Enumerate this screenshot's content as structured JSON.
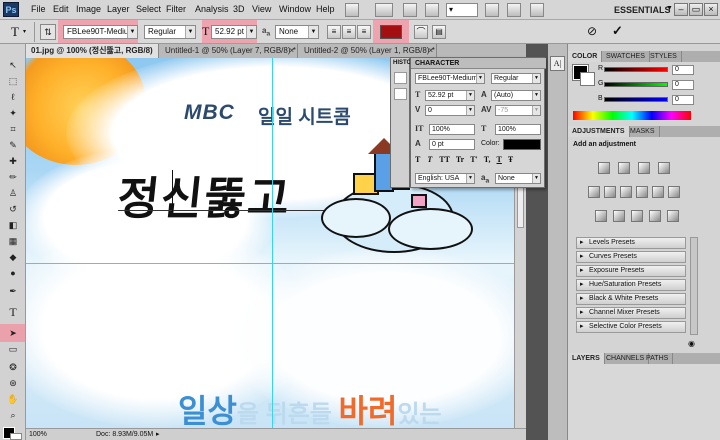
{
  "app": {
    "logo": "Ps",
    "workspace": "ESSENTIALS",
    "workspace_arrow": "▼"
  },
  "menu": [
    "File",
    "Edit",
    "Image",
    "Layer",
    "Select",
    "Filter",
    "Analysis",
    "3D",
    "View",
    "Window",
    "Help"
  ],
  "window_controls": {
    "minimize": "–",
    "restore": "▭",
    "close": "×"
  },
  "options_bar": {
    "font_family": "FBLee90T-Medium",
    "font_style": "Regular",
    "font_size": "52.92 pt",
    "antialias_label": "a",
    "antialias_value": "None",
    "text_color": "#a40f14",
    "cancel_icon": "⊘",
    "commit_icon": "✓"
  },
  "tabs": [
    {
      "label": "01.jpg @ 100% (정신뚫고, RGB/8) *",
      "close": "×",
      "active": true
    },
    {
      "label": "Untitled-1 @ 50% (Layer 7, RGB/8) *",
      "close": "×",
      "active": false
    },
    {
      "label": "Untitled-2 @ 50% (Layer 1, RGB/8) *",
      "close": "×",
      "active": false
    }
  ],
  "canvas": {
    "logo_text": "MBC",
    "subtitle": "일일 시트콤",
    "main_title": "정신뚫고",
    "bottom_segments": [
      "일상",
      "을 뒤흔들 ",
      "바려",
      "있는"
    ]
  },
  "status": {
    "zoom": "100%",
    "doc": "Doc: 8.93M/9.05M"
  },
  "character_panel": {
    "history_label": "HISTO",
    "title": "CHARACTER",
    "font_family": "FBLee90T-Medium",
    "font_style": "Regular",
    "font_size": "52.92 pt",
    "leading": "(Auto)",
    "kerning": "0",
    "tracking": "-75",
    "vertical_scale": "100%",
    "horizontal_scale": "100%",
    "baseline_shift": "0 pt",
    "color_label": "Color:",
    "style_buttons": [
      "T",
      "T",
      "TT",
      "Tr",
      "T'",
      "T,",
      "T",
      "Ŧ"
    ],
    "language": "English: USA",
    "aa_label": "a",
    "aa_value": "None"
  },
  "color_panel": {
    "tabs": [
      "COLOR",
      "SWATCHES",
      "STYLES"
    ],
    "channels": [
      {
        "label": "R",
        "value": "0"
      },
      {
        "label": "G",
        "value": "0"
      },
      {
        "label": "B",
        "value": "0"
      }
    ]
  },
  "adjustments_panel": {
    "tabs": [
      "ADJUSTMENTS",
      "MASKS"
    ],
    "heading": "Add an adjustment",
    "presets": [
      "Levels Presets",
      "Curves Presets",
      "Exposure Presets",
      "Hue/Saturation Presets",
      "Black & White Presets",
      "Channel Mixer Presets",
      "Selective Color Presets"
    ]
  },
  "layers_panel": {
    "tabs": [
      "LAYERS",
      "CHANNELS",
      "PATHS"
    ]
  }
}
